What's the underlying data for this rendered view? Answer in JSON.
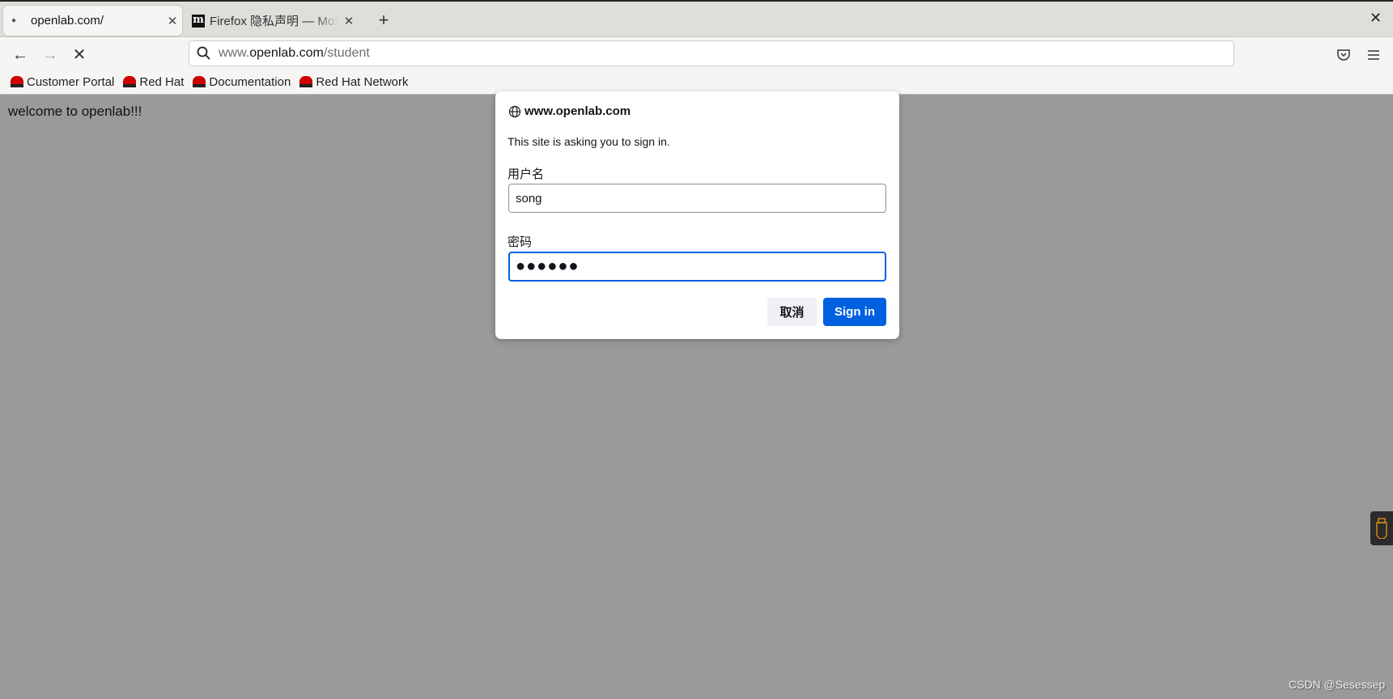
{
  "tabs": [
    {
      "label": "openlab.com/",
      "active": true
    },
    {
      "label": "Firefox 隐私声明 — Mozilla",
      "active": false
    }
  ],
  "url": {
    "prefix": "www.",
    "host": "openlab.com",
    "path": "/student"
  },
  "bookmarks": [
    {
      "label": "Customer Portal"
    },
    {
      "label": "Red Hat"
    },
    {
      "label": "Documentation"
    },
    {
      "label": "Red Hat Network"
    }
  ],
  "page": {
    "welcome": "welcome to openlab!!!"
  },
  "dialog": {
    "host": "www.openlab.com",
    "message": "This site is asking you to sign in.",
    "username_label": "用户名",
    "username_value": "song",
    "password_label": "密码",
    "password_mask": "●●●●●●",
    "cancel_label": "取消",
    "signin_label": "Sign in"
  },
  "watermark": "CSDN @Sesessep",
  "colors": {
    "accent": "#0061e0",
    "content_bg": "#9a9a9c"
  }
}
